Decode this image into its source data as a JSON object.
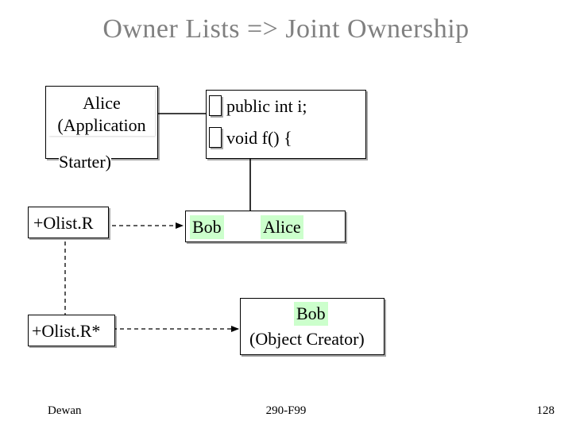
{
  "title": "Owner Lists => Joint Ownership",
  "alice_box": {
    "line1": "Alice",
    "line2": "(Application"
  },
  "starter_label": "Starter)",
  "code": {
    "line1": "public int i;",
    "line2": "void f() {"
  },
  "olist_r": "+Olist.R",
  "bob_label": "Bob",
  "alice_label": "Alice",
  "olist_rstar": "+Olist.R*",
  "bob2": "Bob",
  "creator": "(Object Creator)",
  "footer": {
    "author": "Dewan",
    "course": "290-F99",
    "page": "128"
  }
}
